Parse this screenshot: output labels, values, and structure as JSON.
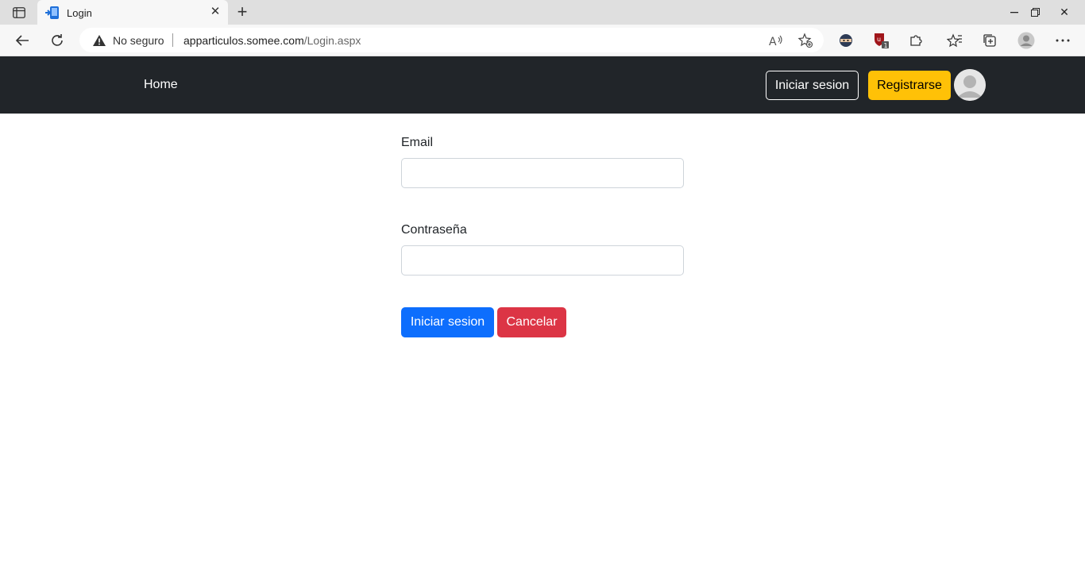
{
  "browser": {
    "tab_title": "Login",
    "new_tab_icon": "plus-icon",
    "security_label": "No seguro",
    "url_host": "apparticulos.somee.com",
    "url_path": "/Login.aspx"
  },
  "navbar": {
    "home_label": "Home",
    "login_label": "Iniciar sesion",
    "register_label": "Registrarse",
    "colors": {
      "background": "#212529",
      "register": "#ffc107"
    }
  },
  "form": {
    "email_label": "Email",
    "email_value": "",
    "password_label": "Contraseña",
    "password_value": "",
    "submit_label": "Iniciar sesion",
    "cancel_label": "Cancelar",
    "colors": {
      "primary": "#0d6efd",
      "danger": "#dc3545"
    }
  }
}
